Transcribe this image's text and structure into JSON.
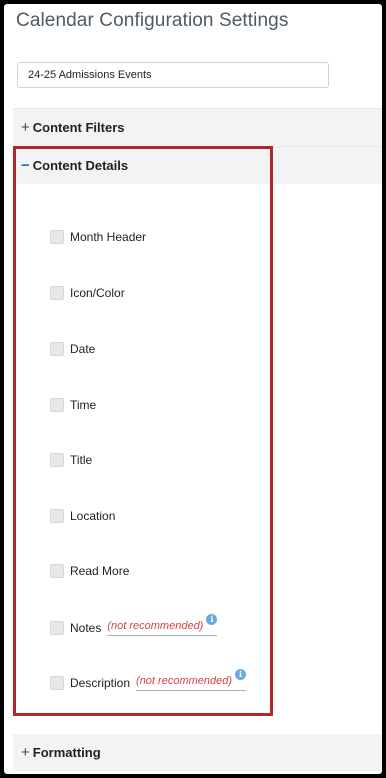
{
  "page": {
    "title": "Calendar Configuration Settings"
  },
  "calendar_name": {
    "value": "24-25 Admissions Events"
  },
  "sections": {
    "filters": {
      "toggle": "+",
      "label": "Content Filters"
    },
    "details": {
      "toggle": "−",
      "label": "Content Details"
    },
    "formatting": {
      "toggle": "+",
      "label": "Formatting"
    }
  },
  "content_details": {
    "items": [
      {
        "label": "Month Header",
        "checked": false,
        "note": ""
      },
      {
        "label": "Icon/Color",
        "checked": false,
        "note": ""
      },
      {
        "label": "Date",
        "checked": false,
        "note": ""
      },
      {
        "label": "Time",
        "checked": false,
        "note": ""
      },
      {
        "label": "Title",
        "checked": false,
        "note": ""
      },
      {
        "label": "Location",
        "checked": false,
        "note": ""
      },
      {
        "label": "Read More",
        "checked": false,
        "note": ""
      },
      {
        "label": "Notes",
        "checked": false,
        "note": "(not recommended)"
      },
      {
        "label": "Description",
        "checked": false,
        "note": "(not recommended)"
      }
    ],
    "info_glyph": "i"
  },
  "colors": {
    "highlight_border": "#b1272b",
    "accent": "#1a73c8",
    "warning_text": "#d04545"
  }
}
